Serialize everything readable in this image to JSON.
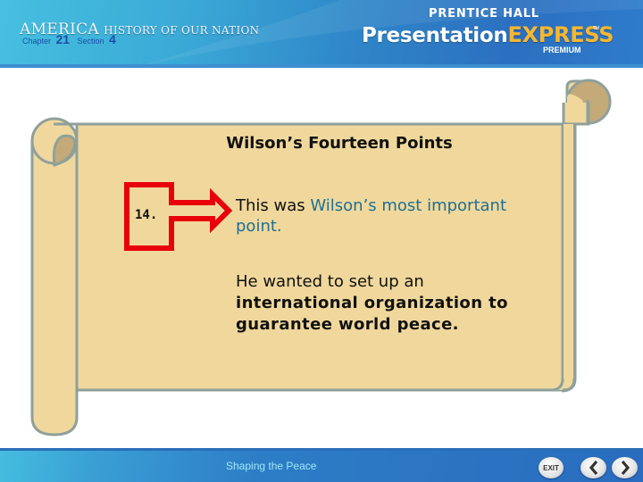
{
  "header": {
    "series_title_big": "AMERICA",
    "series_title_small": "HISTORY OF OUR NATION",
    "chapter_label": "Chapter",
    "chapter_number": "21",
    "section_label": "Section",
    "section_number": "4",
    "publisher": "PRENTICE HALL",
    "product_name": "Presentation",
    "product_highlight": "EXPRESS",
    "trademark": "TM",
    "product_tier": "PREMIUM"
  },
  "slide": {
    "title": "Wilson’s Fourteen Points",
    "point_number": "14.",
    "paragraph1_prefix": "This was ",
    "paragraph1_highlight": "Wilson’s most important point.",
    "paragraph2_prefix": "He wanted to set up an ",
    "paragraph2_bold": "international organization to guarantee world peace."
  },
  "footer": {
    "title": "Shaping the Peace",
    "exit_label": "EXIT",
    "prev_icon": "chevron-left-icon",
    "next_icon": "chevron-right-icon"
  },
  "colors": {
    "scroll_fill": "#f0d89c",
    "scroll_outline": "#8fa09b",
    "scroll_curl": "#c4aa78",
    "arrow_red": "#e8000b",
    "highlight_blue": "#1e6f96",
    "footer_title": "#9fe8f7",
    "header_blue": "#2b6fc0"
  }
}
